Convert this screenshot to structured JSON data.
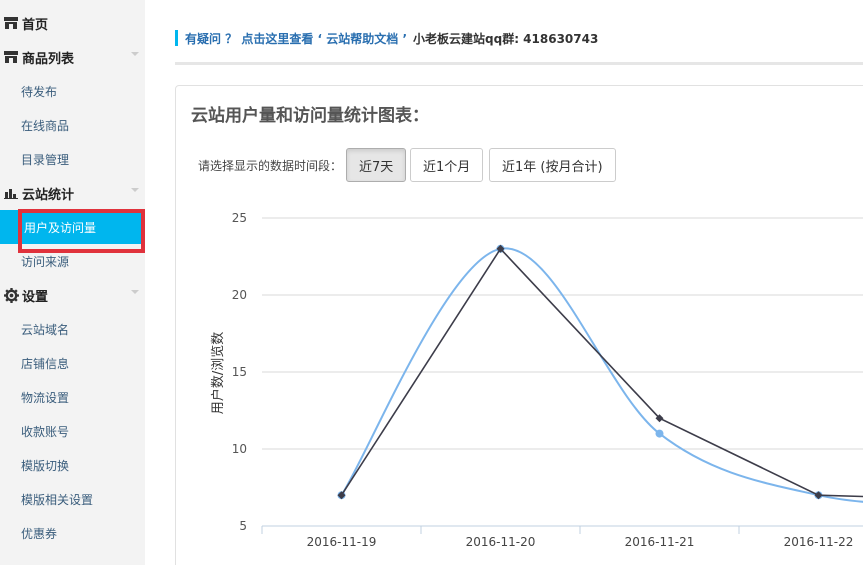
{
  "sidebar": {
    "items": [
      {
        "label": "首页",
        "icon": "store-icon",
        "type": "section"
      },
      {
        "label": "商品列表",
        "icon": "store-icon",
        "type": "section"
      },
      {
        "label": "待发布",
        "type": "sub"
      },
      {
        "label": "在线商品",
        "type": "sub"
      },
      {
        "label": "目录管理",
        "type": "sub"
      },
      {
        "label": "云站统计",
        "icon": "bar-chart-icon",
        "type": "section"
      },
      {
        "label": "用户及访问量",
        "type": "sub",
        "active": true
      },
      {
        "label": "访问来源",
        "type": "sub"
      },
      {
        "label": "设置",
        "icon": "gear-icon",
        "type": "section"
      },
      {
        "label": "云站域名",
        "type": "sub"
      },
      {
        "label": "店铺信息",
        "type": "sub"
      },
      {
        "label": "物流设置",
        "type": "sub"
      },
      {
        "label": "收款账号",
        "type": "sub"
      },
      {
        "label": "模版切换",
        "type": "sub"
      },
      {
        "label": "模版相关设置",
        "type": "sub"
      },
      {
        "label": "优惠券",
        "type": "sub"
      }
    ],
    "active_color": "#00b6ee",
    "highlight_color": "#e0323c"
  },
  "help": {
    "question": "有疑问 ？ 点击这里查看 ‘ 云站帮助文档 ’",
    "qq": "小老板云建站qq群: 418630743"
  },
  "panel": {
    "title": "云站用户量和访问量统计图表：",
    "range_label": "请选择显示的数据时间段：",
    "buttons": [
      {
        "label": "近7天",
        "active": true
      },
      {
        "label": "近1个月",
        "active": false
      },
      {
        "label": "近1年 (按月合计)",
        "active": false
      }
    ]
  },
  "chart_data": {
    "type": "line",
    "ylabel": "用户数/浏览数",
    "ylim": [
      5,
      25
    ],
    "yticks": [
      5,
      10,
      15,
      20,
      25
    ],
    "categories": [
      "2016-11-19",
      "2016-11-20",
      "2016-11-21",
      "2016-11-22"
    ],
    "grid": true,
    "series": [
      {
        "color": "#7cb5ec",
        "smooth": true,
        "values": [
          7,
          23,
          11,
          7,
          6.3
        ]
      },
      {
        "color": "#3d3d4a",
        "smooth": false,
        "values": [
          7,
          23,
          12,
          7,
          6.7
        ]
      }
    ]
  }
}
